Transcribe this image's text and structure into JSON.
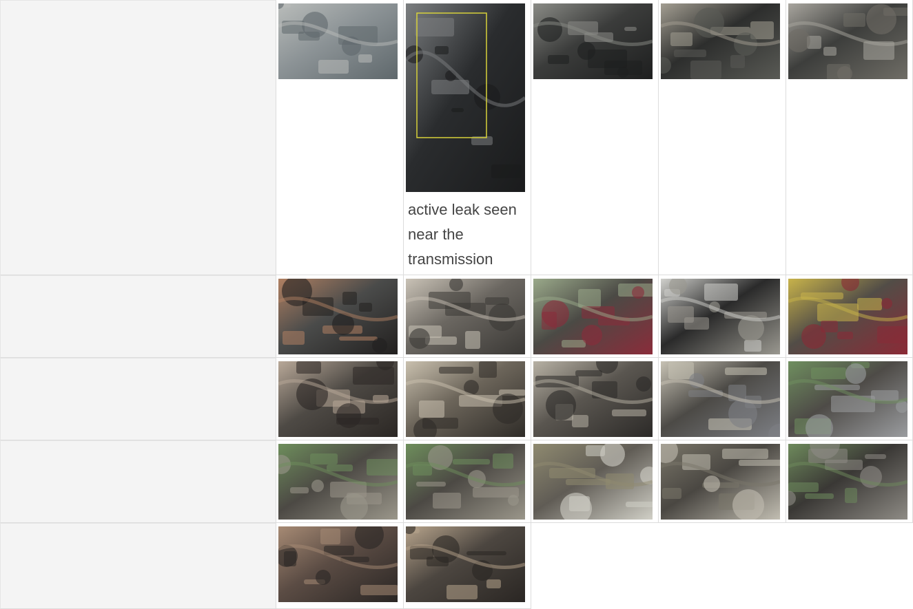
{
  "rows": [
    {
      "label": "",
      "photos": [
        {
          "subject": "eaton-transmission-housing",
          "tone": [
            "#8c9396",
            "#5f686c",
            "#b9bcba"
          ]
        },
        {
          "subject": "transmission-leak-closeup",
          "tone": [
            "#2a2c2e",
            "#1a1b1c",
            "#7b7e80"
          ],
          "caption": "active leak seen near the transmission",
          "highlight_color": "#d8d23a"
        },
        {
          "subject": "oil-pan-underside",
          "tone": [
            "#3b3c3b",
            "#1e1f1f",
            "#8a8b86"
          ]
        },
        {
          "subject": "frame-crossmember",
          "tone": [
            "#2d2e2d",
            "#595a55",
            "#a39e92"
          ]
        },
        {
          "subject": "wiring-harness-bracket",
          "tone": [
            "#3d3e3c",
            "#6f6d66",
            "#a8a59e"
          ]
        }
      ]
    },
    {
      "label": "",
      "photos": [
        {
          "subject": "driveshaft-yoke",
          "tone": [
            "#4a4b4a",
            "#22201f",
            "#b08062"
          ]
        },
        {
          "subject": "exhaust-and-frame",
          "tone": [
            "#6b6761",
            "#3a3835",
            "#c9c2b6"
          ]
        },
        {
          "subject": "brake-lines-wiring",
          "tone": [
            "#4b4a45",
            "#8a2c3a",
            "#9aa98a"
          ]
        },
        {
          "subject": "fuel-tank-wheel",
          "tone": [
            "#2a2a2a",
            "#9a9890",
            "#d0d0cc"
          ]
        },
        {
          "subject": "air-lines-harness",
          "tone": [
            "#524d47",
            "#8b2a36",
            "#c8b34a"
          ]
        }
      ]
    },
    {
      "label": "",
      "photos": [
        {
          "subject": "driveshaft-center-bearing",
          "tone": [
            "#4e4a45",
            "#2b2724",
            "#b8a898"
          ]
        },
        {
          "subject": "differential-housing",
          "tone": [
            "#6c655a",
            "#2f2c28",
            "#c9c0ae"
          ]
        },
        {
          "subject": "air-brake-chamber",
          "tone": [
            "#5a5650",
            "#2c2a28",
            "#b7b1a4"
          ]
        },
        {
          "subject": "leveling-valve",
          "tone": [
            "#4c4a46",
            "#7d7f84",
            "#c7c2b4"
          ]
        },
        {
          "subject": "air-valve-fitting",
          "tone": [
            "#4e4b47",
            "#9a9c9f",
            "#6f8f5f"
          ]
        }
      ]
    },
    {
      "label": "",
      "photos": [
        {
          "subject": "relay-valve-assembly",
          "tone": [
            "#4c4944",
            "#9a968a",
            "#6e8e5c"
          ]
        },
        {
          "subject": "relay-valve-assembly-2",
          "tone": [
            "#4c4944",
            "#9a968a",
            "#6e8e5c"
          ]
        },
        {
          "subject": "rear-crossmember",
          "tone": [
            "#605c55",
            "#d0cfc6",
            "#8f8a70"
          ]
        },
        {
          "subject": "air-line-routing",
          "tone": [
            "#4a4742",
            "#c1bdb1",
            "#7a7669"
          ]
        },
        {
          "subject": "brake-valve-frame",
          "tone": [
            "#3a3835",
            "#8e8b85",
            "#6e8a5c"
          ]
        }
      ]
    },
    {
      "label": "",
      "photos": [
        {
          "subject": "rear-suspension-hub",
          "tone": [
            "#5b4c44",
            "#2a2624",
            "#a68a74"
          ]
        },
        {
          "subject": "suspension-mount",
          "tone": [
            "#4c4640",
            "#2a2623",
            "#b7a48c"
          ]
        }
      ]
    }
  ]
}
